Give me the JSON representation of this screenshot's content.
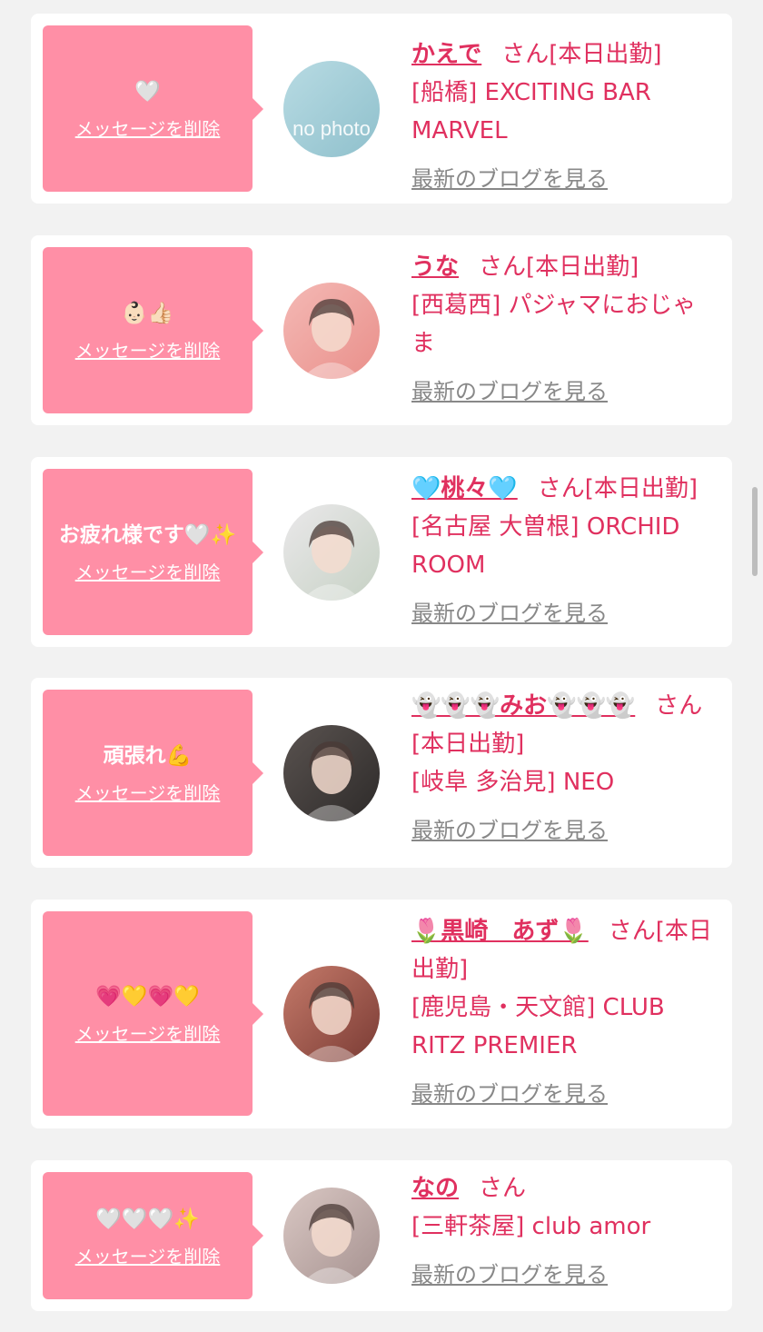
{
  "delete_label": "メッセージを削除",
  "blog_label": "最新のブログを見る",
  "honorific": "さん",
  "cards": [
    {
      "message": "🤍",
      "name": "かえで",
      "status": "[本日出勤]",
      "shop": "[船橋] EXCITING BAR MARVEL",
      "avatar": "no photo",
      "avatar_colors": [
        "#b8dbe3",
        "#8fc0cc"
      ]
    },
    {
      "message": "👶🏻👍🏻",
      "name": "うな",
      "status": "[本日出勤]",
      "shop": "[西葛西] パジャマにおじゃま",
      "avatar": "",
      "avatar_colors": [
        "#f4b9b5",
        "#e98f8a"
      ]
    },
    {
      "message": "お疲れ様です🤍✨",
      "name": "🩵桃々🩵",
      "status": "[本日出勤]",
      "shop": "[名古屋 大曽根] ORCHID ROOM",
      "avatar": "",
      "avatar_colors": [
        "#eae8ea",
        "#c6d1c4"
      ]
    },
    {
      "message": "頑張れ💪",
      "name": "👻👻👻みお👻👻👻",
      "status": "[本日出勤]",
      "shop": "[岐阜 多治見] NEO",
      "avatar": "",
      "avatar_colors": [
        "#5a5350",
        "#2d2a29"
      ]
    },
    {
      "message": "💗💛💗💛",
      "name": "🌷黒崎　あず🌷",
      "status": "[本日出勤]",
      "shop": "[鹿児島・天文館] CLUB RITZ PREMIER",
      "avatar": "",
      "avatar_colors": [
        "#c57a6a",
        "#7a3b34"
      ]
    },
    {
      "message": "🤍🤍🤍✨",
      "name": "なの",
      "status": "",
      "shop": "[三軒茶屋] club amor",
      "avatar": "",
      "avatar_colors": [
        "#d9c7c3",
        "#a69290"
      ]
    }
  ]
}
